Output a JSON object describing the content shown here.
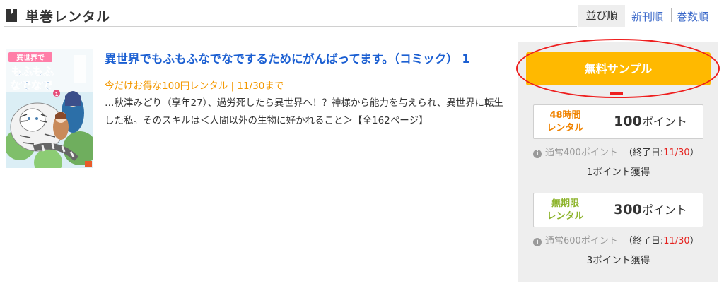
{
  "header": {
    "section_title": "単巻レンタル",
    "sort_label": "並び順",
    "sort_newest": "新刊順",
    "sort_volume": "巻数順"
  },
  "book": {
    "title": "異世界でもふもふなでなでするためにがんばってます。（コミック） 1",
    "rental_offer": "今だけお得な100円レンタル | 11/30まで",
    "description": "…秋津みどり（享年27）、過労死したら異世界へ！？神様から能力を与えられ、異世界に転生した私。そのスキルは＜人間以外の生物に好かれること＞【全162ページ】",
    "cover": {
      "title_text": "異世界でもふもふなでなで",
      "volume": "1"
    }
  },
  "sidebar": {
    "sample_button": "無料サンプル",
    "plans": [
      {
        "duration_line1": "48時間",
        "duration_line2": "レンタル",
        "points_value": "100",
        "points_unit": "ポイント",
        "old_price": "通常400ポイント",
        "end_prefix": "（終了日:",
        "end_date": "11/30",
        "end_suffix": "）",
        "earn": "1ポイント獲得"
      },
      {
        "duration_line1": "無期限",
        "duration_line2": "レンタル",
        "points_value": "300",
        "points_unit": "ポイント",
        "old_price": "通常600ポイント",
        "end_prefix": "（終了日:",
        "end_date": "11/30",
        "end_suffix": "）",
        "earn": "3ポイント獲得"
      }
    ]
  },
  "colors": {
    "title_link": "#1b5fd2",
    "offer_orange": "#f39800",
    "sample_button": "#ffb900",
    "annotation_red": "#ee1f1f",
    "end_date_red": "#e5211e",
    "unlimited_green": "#8cb32a"
  },
  "icons": [
    "book-icon",
    "info-icon"
  ]
}
